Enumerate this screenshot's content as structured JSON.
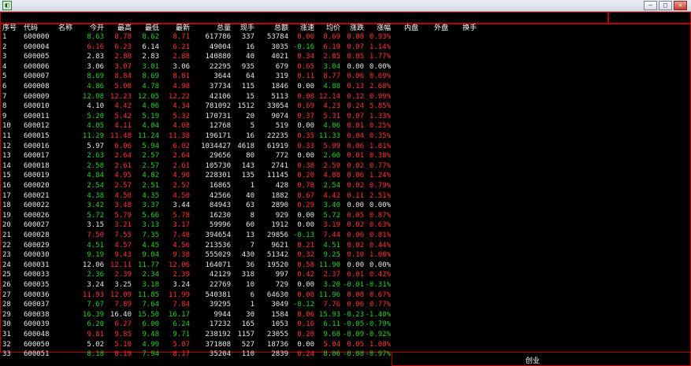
{
  "window": {
    "icon": "app-logo-icon",
    "buttons": [
      "–",
      "□",
      "✕"
    ]
  },
  "columns": [
    "序号",
    "代码",
    "名称",
    "今开",
    "最高",
    "最低",
    "最新",
    "总量",
    "现手",
    "总额",
    "涨速",
    "均价",
    "涨跌",
    "涨幅",
    "内盘",
    "外盘",
    "换手"
  ],
  "colors": {
    "up": "#ff3030",
    "down": "#20d020",
    "flat": "#e8e8e8",
    "border": "#c00000"
  },
  "rows": [
    [
      "1",
      "600000",
      "",
      "8.63",
      "8.78",
      "8.62",
      "8.71",
      "617786",
      "337",
      "53784",
      "0.00",
      "8.69",
      "0.08",
      "0.93%"
    ],
    [
      "2",
      "600004",
      "",
      "6.16",
      "6.23",
      "6.14",
      "6.21",
      "49004",
      "16",
      "3035",
      "-0.16",
      "6.19",
      "0.07",
      "1.14%"
    ],
    [
      "3",
      "600005",
      "",
      "2.83",
      "2.88",
      "2.83",
      "2.88",
      "140880",
      "40",
      "4021",
      "0.34",
      "2.85",
      "0.05",
      "1.77%"
    ],
    [
      "4",
      "600006",
      "",
      "3.06",
      "3.07",
      "3.01",
      "3.06",
      "22295",
      "935",
      "679",
      "0.65",
      "3.04",
      "0.00",
      "0.00%"
    ],
    [
      "5",
      "600007",
      "",
      "8.69",
      "8.84",
      "8.69",
      "8.81",
      "3644",
      "64",
      "319",
      "0.11",
      "8.77",
      "0.06",
      "0.69%"
    ],
    [
      "6",
      "600008",
      "",
      "4.86",
      "5.00",
      "4.78",
      "4.98",
      "37734",
      "115",
      "1846",
      "0.00",
      "4.88",
      "0.13",
      "2.68%"
    ],
    [
      "7",
      "600009",
      "",
      "12.08",
      "12.23",
      "12.05",
      "12.22",
      "42106",
      "15",
      "5113",
      "0.08",
      "12.14",
      "0.12",
      "0.99%"
    ],
    [
      "8",
      "600010",
      "",
      "4.10",
      "4.42",
      "4.06",
      "4.34",
      "781092",
      "1512",
      "33054",
      "0.69",
      "4.23",
      "0.24",
      "5.85%"
    ],
    [
      "9",
      "600011",
      "",
      "5.20",
      "5.42",
      "5.19",
      "5.32",
      "170731",
      "20",
      "9074",
      "0.37",
      "5.31",
      "0.07",
      "1.33%"
    ],
    [
      "10",
      "600012",
      "",
      "4.05",
      "4.11",
      "4.04",
      "4.08",
      "12768",
      "5",
      "519",
      "0.00",
      "4.06",
      "0.01",
      "0.25%"
    ],
    [
      "11",
      "600015",
      "",
      "11.29",
      "11.48",
      "11.24",
      "11.38",
      "196171",
      "16",
      "22235",
      "0.35",
      "11.33",
      "0.04",
      "0.35%"
    ],
    [
      "12",
      "600016",
      "",
      "5.97",
      "6.06",
      "5.94",
      "6.02",
      "1034427",
      "4618",
      "61919",
      "0.33",
      "5.99",
      "0.06",
      "1.01%"
    ],
    [
      "13",
      "600017",
      "",
      "2.63",
      "2.64",
      "2.57",
      "2.64",
      "29656",
      "80",
      "772",
      "0.00",
      "2.60",
      "0.01",
      "0.38%"
    ],
    [
      "14",
      "600018",
      "",
      "2.58",
      "2.61",
      "2.57",
      "2.61",
      "105730",
      "143",
      "2741",
      "0.38",
      "2.59",
      "0.02",
      "0.77%"
    ],
    [
      "15",
      "600019",
      "",
      "4.84",
      "4.95",
      "4.82",
      "4.90",
      "228301",
      "135",
      "11145",
      "0.20",
      "4.88",
      "0.06",
      "1.24%"
    ],
    [
      "16",
      "600020",
      "",
      "2.54",
      "2.57",
      "2.51",
      "2.57",
      "16865",
      "1",
      "428",
      "0.78",
      "2.54",
      "0.02",
      "0.79%"
    ],
    [
      "17",
      "600021",
      "",
      "4.38",
      "4.50",
      "4.35",
      "4.50",
      "42566",
      "40",
      "1882",
      "0.67",
      "4.42",
      "0.11",
      "2.51%"
    ],
    [
      "18",
      "600022",
      "",
      "3.42",
      "3.48",
      "3.37",
      "3.44",
      "84943",
      "63",
      "2890",
      "0.29",
      "3.40",
      "0.00",
      "0.00%"
    ],
    [
      "19",
      "600026",
      "",
      "5.72",
      "5.79",
      "5.66",
      "5.78",
      "16230",
      "8",
      "929",
      "0.00",
      "5.72",
      "0.05",
      "0.87%"
    ],
    [
      "20",
      "600027",
      "",
      "3.15",
      "3.21",
      "3.13",
      "3.17",
      "59996",
      "60",
      "1912",
      "0.00",
      "3.19",
      "0.02",
      "0.63%"
    ],
    [
      "21",
      "600028",
      "",
      "7.50",
      "7.55",
      "7.35",
      "7.48",
      "394654",
      "13",
      "29856",
      "-0.13",
      "7.44",
      "0.06",
      "0.81%"
    ],
    [
      "22",
      "600029",
      "",
      "4.51",
      "4.57",
      "4.45",
      "4.56",
      "213536",
      "7",
      "9621",
      "0.21",
      "4.51",
      "0.02",
      "0.44%"
    ],
    [
      "23",
      "600030",
      "",
      "9.19",
      "9.43",
      "9.04",
      "9.38",
      "555029",
      "430",
      "51342",
      "0.32",
      "9.25",
      "0.10",
      "1.08%"
    ],
    [
      "24",
      "600031",
      "",
      "12.06",
      "12.11",
      "11.77",
      "12.06",
      "164071",
      "36",
      "19520",
      "0.58",
      "11.90",
      "0.00",
      "0.00%"
    ],
    [
      "25",
      "600033",
      "",
      "2.36",
      "2.39",
      "2.34",
      "2.39",
      "42129",
      "318",
      "997",
      "0.42",
      "2.37",
      "0.01",
      "0.42%"
    ],
    [
      "26",
      "600035",
      "",
      "3.24",
      "3.25",
      "3.18",
      "3.24",
      "22769",
      "10",
      "729",
      "0.00",
      "3.20",
      "-0.01",
      "-0.31%"
    ],
    [
      "27",
      "600036",
      "",
      "11.93",
      "12.09",
      "11.85",
      "11.99",
      "540381",
      "6",
      "64630",
      "0.08",
      "11.96",
      "0.08",
      "0.67%"
    ],
    [
      "28",
      "600037",
      "",
      "7.67",
      "7.89",
      "7.64",
      "7.84",
      "39295",
      "1",
      "3049",
      "-0.12",
      "7.76",
      "0.06",
      "0.77%"
    ],
    [
      "29",
      "600038",
      "",
      "16.39",
      "16.40",
      "15.50",
      "16.17",
      "9944",
      "30",
      "1584",
      "0.06",
      "15.93",
      "-0.23",
      "-1.40%"
    ],
    [
      "30",
      "600039",
      "",
      "6.20",
      "6.27",
      "6.00",
      "6.24",
      "17232",
      "165",
      "1053",
      "0.16",
      "6.11",
      "-0.05",
      "-0.79%"
    ],
    [
      "31",
      "600048",
      "",
      "9.81",
      "9.85",
      "9.48",
      "9.71",
      "238192",
      "1157",
      "23055",
      "0.20",
      "9.68",
      "-0.09",
      "-0.92%"
    ],
    [
      "32",
      "600050",
      "",
      "5.02",
      "5.10",
      "4.99",
      "5.07",
      "371808",
      "527",
      "18736",
      "0.00",
      "5.04",
      "0.05",
      "1.00%"
    ],
    [
      "33",
      "600051",
      "",
      "8.18",
      "8.19",
      "7.94",
      "8.17",
      "35204",
      "110",
      "2839",
      "0.24",
      "8.06",
      "-0.08",
      "-0.97%"
    ]
  ],
  "row_colors": [
    [
      "w",
      "w",
      "w",
      "g",
      "r",
      "g",
      "r",
      "w",
      "w",
      "w",
      "r",
      "r",
      "r",
      "r"
    ],
    [
      "w",
      "w",
      "w",
      "r",
      "r",
      "w",
      "r",
      "w",
      "w",
      "w",
      "g",
      "r",
      "r",
      "r"
    ],
    [
      "w",
      "w",
      "w",
      "w",
      "r",
      "w",
      "r",
      "w",
      "w",
      "w",
      "r",
      "r",
      "r",
      "r"
    ],
    [
      "w",
      "w",
      "w",
      "w",
      "r",
      "g",
      "w",
      "w",
      "w",
      "w",
      "r",
      "g",
      "w",
      "w"
    ],
    [
      "w",
      "w",
      "w",
      "g",
      "r",
      "g",
      "r",
      "w",
      "w",
      "w",
      "r",
      "r",
      "r",
      "r"
    ],
    [
      "w",
      "w",
      "w",
      "g",
      "r",
      "g",
      "r",
      "w",
      "w",
      "w",
      "w",
      "g",
      "r",
      "r"
    ],
    [
      "w",
      "w",
      "w",
      "g",
      "r",
      "g",
      "r",
      "w",
      "w",
      "w",
      "r",
      "r",
      "r",
      "r"
    ],
    [
      "w",
      "w",
      "w",
      "w",
      "r",
      "g",
      "r",
      "w",
      "w",
      "w",
      "r",
      "r",
      "r",
      "r"
    ],
    [
      "w",
      "w",
      "w",
      "g",
      "r",
      "g",
      "r",
      "w",
      "w",
      "w",
      "r",
      "r",
      "r",
      "r"
    ],
    [
      "w",
      "w",
      "w",
      "g",
      "r",
      "g",
      "r",
      "w",
      "w",
      "w",
      "w",
      "g",
      "r",
      "r"
    ],
    [
      "w",
      "w",
      "w",
      "g",
      "r",
      "g",
      "r",
      "w",
      "w",
      "w",
      "r",
      "g",
      "r",
      "r"
    ],
    [
      "w",
      "w",
      "w",
      "w",
      "r",
      "g",
      "r",
      "w",
      "w",
      "w",
      "r",
      "r",
      "r",
      "r"
    ],
    [
      "w",
      "w",
      "w",
      "g",
      "r",
      "g",
      "r",
      "w",
      "w",
      "w",
      "w",
      "g",
      "r",
      "r"
    ],
    [
      "w",
      "w",
      "w",
      "g",
      "r",
      "g",
      "r",
      "w",
      "w",
      "w",
      "r",
      "r",
      "r",
      "r"
    ],
    [
      "w",
      "w",
      "w",
      "g",
      "r",
      "g",
      "r",
      "w",
      "w",
      "w",
      "r",
      "r",
      "r",
      "r"
    ],
    [
      "w",
      "w",
      "w",
      "g",
      "r",
      "g",
      "r",
      "w",
      "w",
      "w",
      "r",
      "g",
      "r",
      "r"
    ],
    [
      "w",
      "w",
      "w",
      "g",
      "r",
      "g",
      "r",
      "w",
      "w",
      "w",
      "r",
      "r",
      "r",
      "r"
    ],
    [
      "w",
      "w",
      "w",
      "g",
      "r",
      "g",
      "w",
      "w",
      "w",
      "w",
      "r",
      "g",
      "w",
      "w"
    ],
    [
      "w",
      "w",
      "w",
      "g",
      "r",
      "g",
      "r",
      "w",
      "w",
      "w",
      "w",
      "g",
      "r",
      "r"
    ],
    [
      "w",
      "w",
      "w",
      "w",
      "r",
      "g",
      "r",
      "w",
      "w",
      "w",
      "w",
      "r",
      "r",
      "r"
    ],
    [
      "w",
      "w",
      "w",
      "r",
      "r",
      "g",
      "r",
      "w",
      "w",
      "w",
      "g",
      "r",
      "r",
      "r"
    ],
    [
      "w",
      "w",
      "w",
      "g",
      "r",
      "g",
      "r",
      "w",
      "w",
      "w",
      "r",
      "g",
      "r",
      "r"
    ],
    [
      "w",
      "w",
      "w",
      "g",
      "r",
      "g",
      "r",
      "w",
      "w",
      "w",
      "r",
      "g",
      "r",
      "r"
    ],
    [
      "w",
      "w",
      "w",
      "w",
      "r",
      "g",
      "r",
      "w",
      "w",
      "w",
      "r",
      "g",
      "w",
      "w"
    ],
    [
      "w",
      "w",
      "w",
      "g",
      "r",
      "g",
      "r",
      "w",
      "w",
      "w",
      "r",
      "r",
      "r",
      "r"
    ],
    [
      "w",
      "w",
      "w",
      "w",
      "w",
      "g",
      "w",
      "w",
      "w",
      "w",
      "w",
      "g",
      "g",
      "g"
    ],
    [
      "w",
      "w",
      "w",
      "r",
      "r",
      "g",
      "r",
      "w",
      "w",
      "w",
      "r",
      "g",
      "r",
      "r"
    ],
    [
      "w",
      "w",
      "w",
      "g",
      "r",
      "g",
      "r",
      "w",
      "w",
      "w",
      "g",
      "r",
      "r",
      "r"
    ],
    [
      "w",
      "w",
      "w",
      "g",
      "w",
      "g",
      "g",
      "w",
      "w",
      "w",
      "r",
      "g",
      "g",
      "g"
    ],
    [
      "w",
      "w",
      "w",
      "g",
      "r",
      "g",
      "g",
      "w",
      "w",
      "w",
      "r",
      "g",
      "g",
      "g"
    ],
    [
      "w",
      "w",
      "w",
      "r",
      "r",
      "g",
      "g",
      "w",
      "w",
      "w",
      "r",
      "g",
      "g",
      "g"
    ],
    [
      "w",
      "w",
      "w",
      "w",
      "r",
      "g",
      "r",
      "w",
      "w",
      "w",
      "w",
      "r",
      "r",
      "r"
    ],
    [
      "w",
      "w",
      "w",
      "g",
      "r",
      "g",
      "r",
      "w",
      "w",
      "w",
      "r",
      "g",
      "g",
      "g"
    ]
  ],
  "bottom_tab": "创业"
}
